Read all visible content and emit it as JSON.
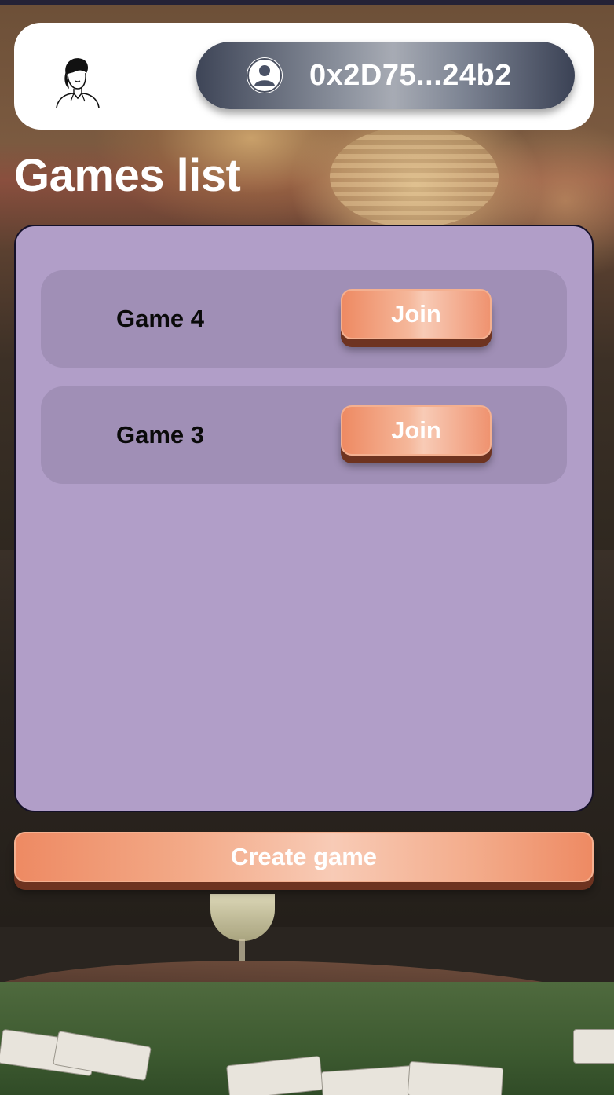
{
  "header": {
    "wallet_address": "0x2D75...24b2"
  },
  "page_title": "Games list",
  "games": [
    {
      "name": "Game 4",
      "join_label": "Join"
    },
    {
      "name": "Game 3",
      "join_label": "Join"
    }
  ],
  "create_game_label": "Create game",
  "icons": {
    "avatar": "user-portrait-icon",
    "wallet": "account-circle-icon"
  },
  "colors": {
    "accent": "#ee8a63",
    "panel": "#b19ec8",
    "row": "#a08fb6",
    "wallet_button": "#3e4557"
  }
}
